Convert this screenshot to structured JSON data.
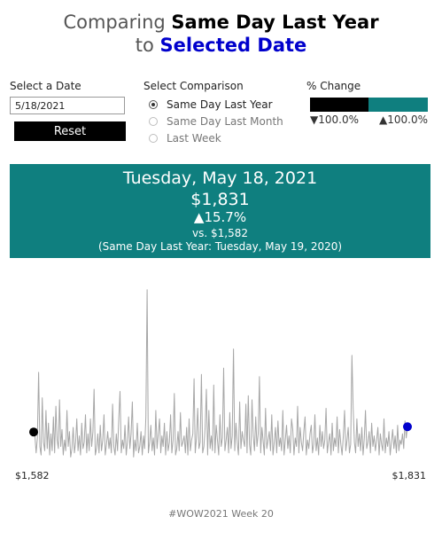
{
  "title": {
    "prefix": "Comparing ",
    "comparison": "Same Day Last Year",
    "connector": "to ",
    "selected": "Selected Date"
  },
  "controls": {
    "date_label": "Select a Date",
    "date_value": "5/18/2021",
    "reset_label": "Reset",
    "comparison_label": "Select Comparison",
    "options": [
      {
        "label": "Same Day Last Year",
        "selected": true
      },
      {
        "label": "Same Day Last Month",
        "selected": false
      },
      {
        "label": "Last Week",
        "selected": false
      }
    ]
  },
  "pct_legend": {
    "label": "% Change",
    "neg_label": "▼100.0%",
    "pos_label": "▲100.0%",
    "neg_color": "#000000",
    "pos_color": "#0f7f7f"
  },
  "banner": {
    "date": "Tuesday, May 18, 2021",
    "value": "$1,831",
    "pct_change": "▲15.7%",
    "vs_text": "vs. $1,582",
    "comparison_text": "(Same Day Last Year: Tuesday, May 19, 2020)",
    "color": "#0f7f7f"
  },
  "chart_data": {
    "type": "line",
    "line_color": "#a6a6a6",
    "start_color": "#000000",
    "end_color": "#0000cc",
    "start_label": "$1,582",
    "end_label": "$1,831",
    "ylim": [
      0,
      9000
    ],
    "values": [
      1582,
      1400,
      600,
      1300,
      4400,
      900,
      500,
      3200,
      1100,
      700,
      2600,
      800,
      2000,
      500,
      1500,
      700,
      2300,
      600,
      2800,
      1200,
      800,
      3100,
      900,
      1700,
      500,
      1200,
      700,
      2600,
      900,
      1600,
      400,
      800,
      1800,
      600,
      1100,
      2200,
      700,
      1400,
      500,
      2000,
      800,
      1100,
      2400,
      600,
      1500,
      700,
      2200,
      900,
      1600,
      3600,
      500,
      800,
      1500,
      600,
      1900,
      700,
      1200,
      2400,
      500,
      1000,
      1600,
      800,
      1300,
      600,
      2900,
      900,
      500,
      1500,
      700,
      2200,
      3500,
      600,
      1200,
      800,
      1900,
      500,
      1100,
      2300,
      800,
      1500,
      3000,
      400,
      1200,
      700,
      2000,
      600,
      900,
      1600,
      500,
      1400,
      800,
      2300,
      8300,
      600,
      1100,
      1900,
      700,
      1300,
      500,
      2600,
      800,
      1500,
      2200,
      600,
      1400,
      900,
      2000,
      500,
      1600,
      700,
      1100,
      2400,
      600,
      1200,
      3400,
      500,
      800,
      1600,
      700,
      2500,
      900,
      1100,
      1400,
      600,
      1800,
      500,
      2200,
      700,
      1200,
      1500,
      4100,
      600,
      1300,
      2700,
      800,
      1100,
      4300,
      600,
      900,
      1800,
      3600,
      500,
      2600,
      800,
      1400,
      700,
      3800,
      600,
      1900,
      1200,
      500,
      2400,
      900,
      1300,
      4600,
      700,
      1200,
      1800,
      600,
      2500,
      800,
      1400,
      5500,
      700,
      2000,
      1100,
      500,
      3000,
      800,
      1600,
      1200,
      900,
      2900,
      600,
      3300,
      1000,
      500,
      3100,
      1400,
      700,
      2300,
      900,
      1500,
      4200,
      600,
      1800,
      1200,
      500,
      2700,
      800,
      1200,
      1600,
      700,
      2400,
      500,
      1100,
      1800,
      600,
      2100,
      900,
      1300,
      700,
      2600,
      500,
      1200,
      1900,
      800,
      1400,
      600,
      2200,
      1700,
      500,
      1300,
      900,
      2800,
      600,
      1800,
      1100,
      700,
      1600,
      2300,
      500,
      1200,
      800,
      1500,
      1900,
      600,
      1000,
      2400,
      700,
      1300,
      500,
      1900,
      900,
      1600,
      800,
      1200,
      2700,
      600,
      1100,
      1500,
      500,
      2000,
      700,
      1300,
      900,
      2300,
      600,
      1700,
      1000,
      500,
      1400,
      2600,
      700,
      1200,
      1800,
      600,
      1000,
      5200,
      2700,
      1100,
      600,
      2200,
      900,
      1500,
      700,
      1800,
      500,
      1300,
      2600,
      800,
      1100,
      1600,
      600,
      2000,
      900,
      1400,
      700,
      1200,
      1800,
      500,
      1500,
      1000,
      700,
      2200,
      600,
      1300,
      900,
      1600,
      500,
      1100,
      1700,
      800,
      1400,
      600,
      1900,
      700,
      1200,
      1000,
      1500,
      800,
      2100,
      1300,
      1831
    ]
  },
  "footer": "#WOW2021 Week 20"
}
